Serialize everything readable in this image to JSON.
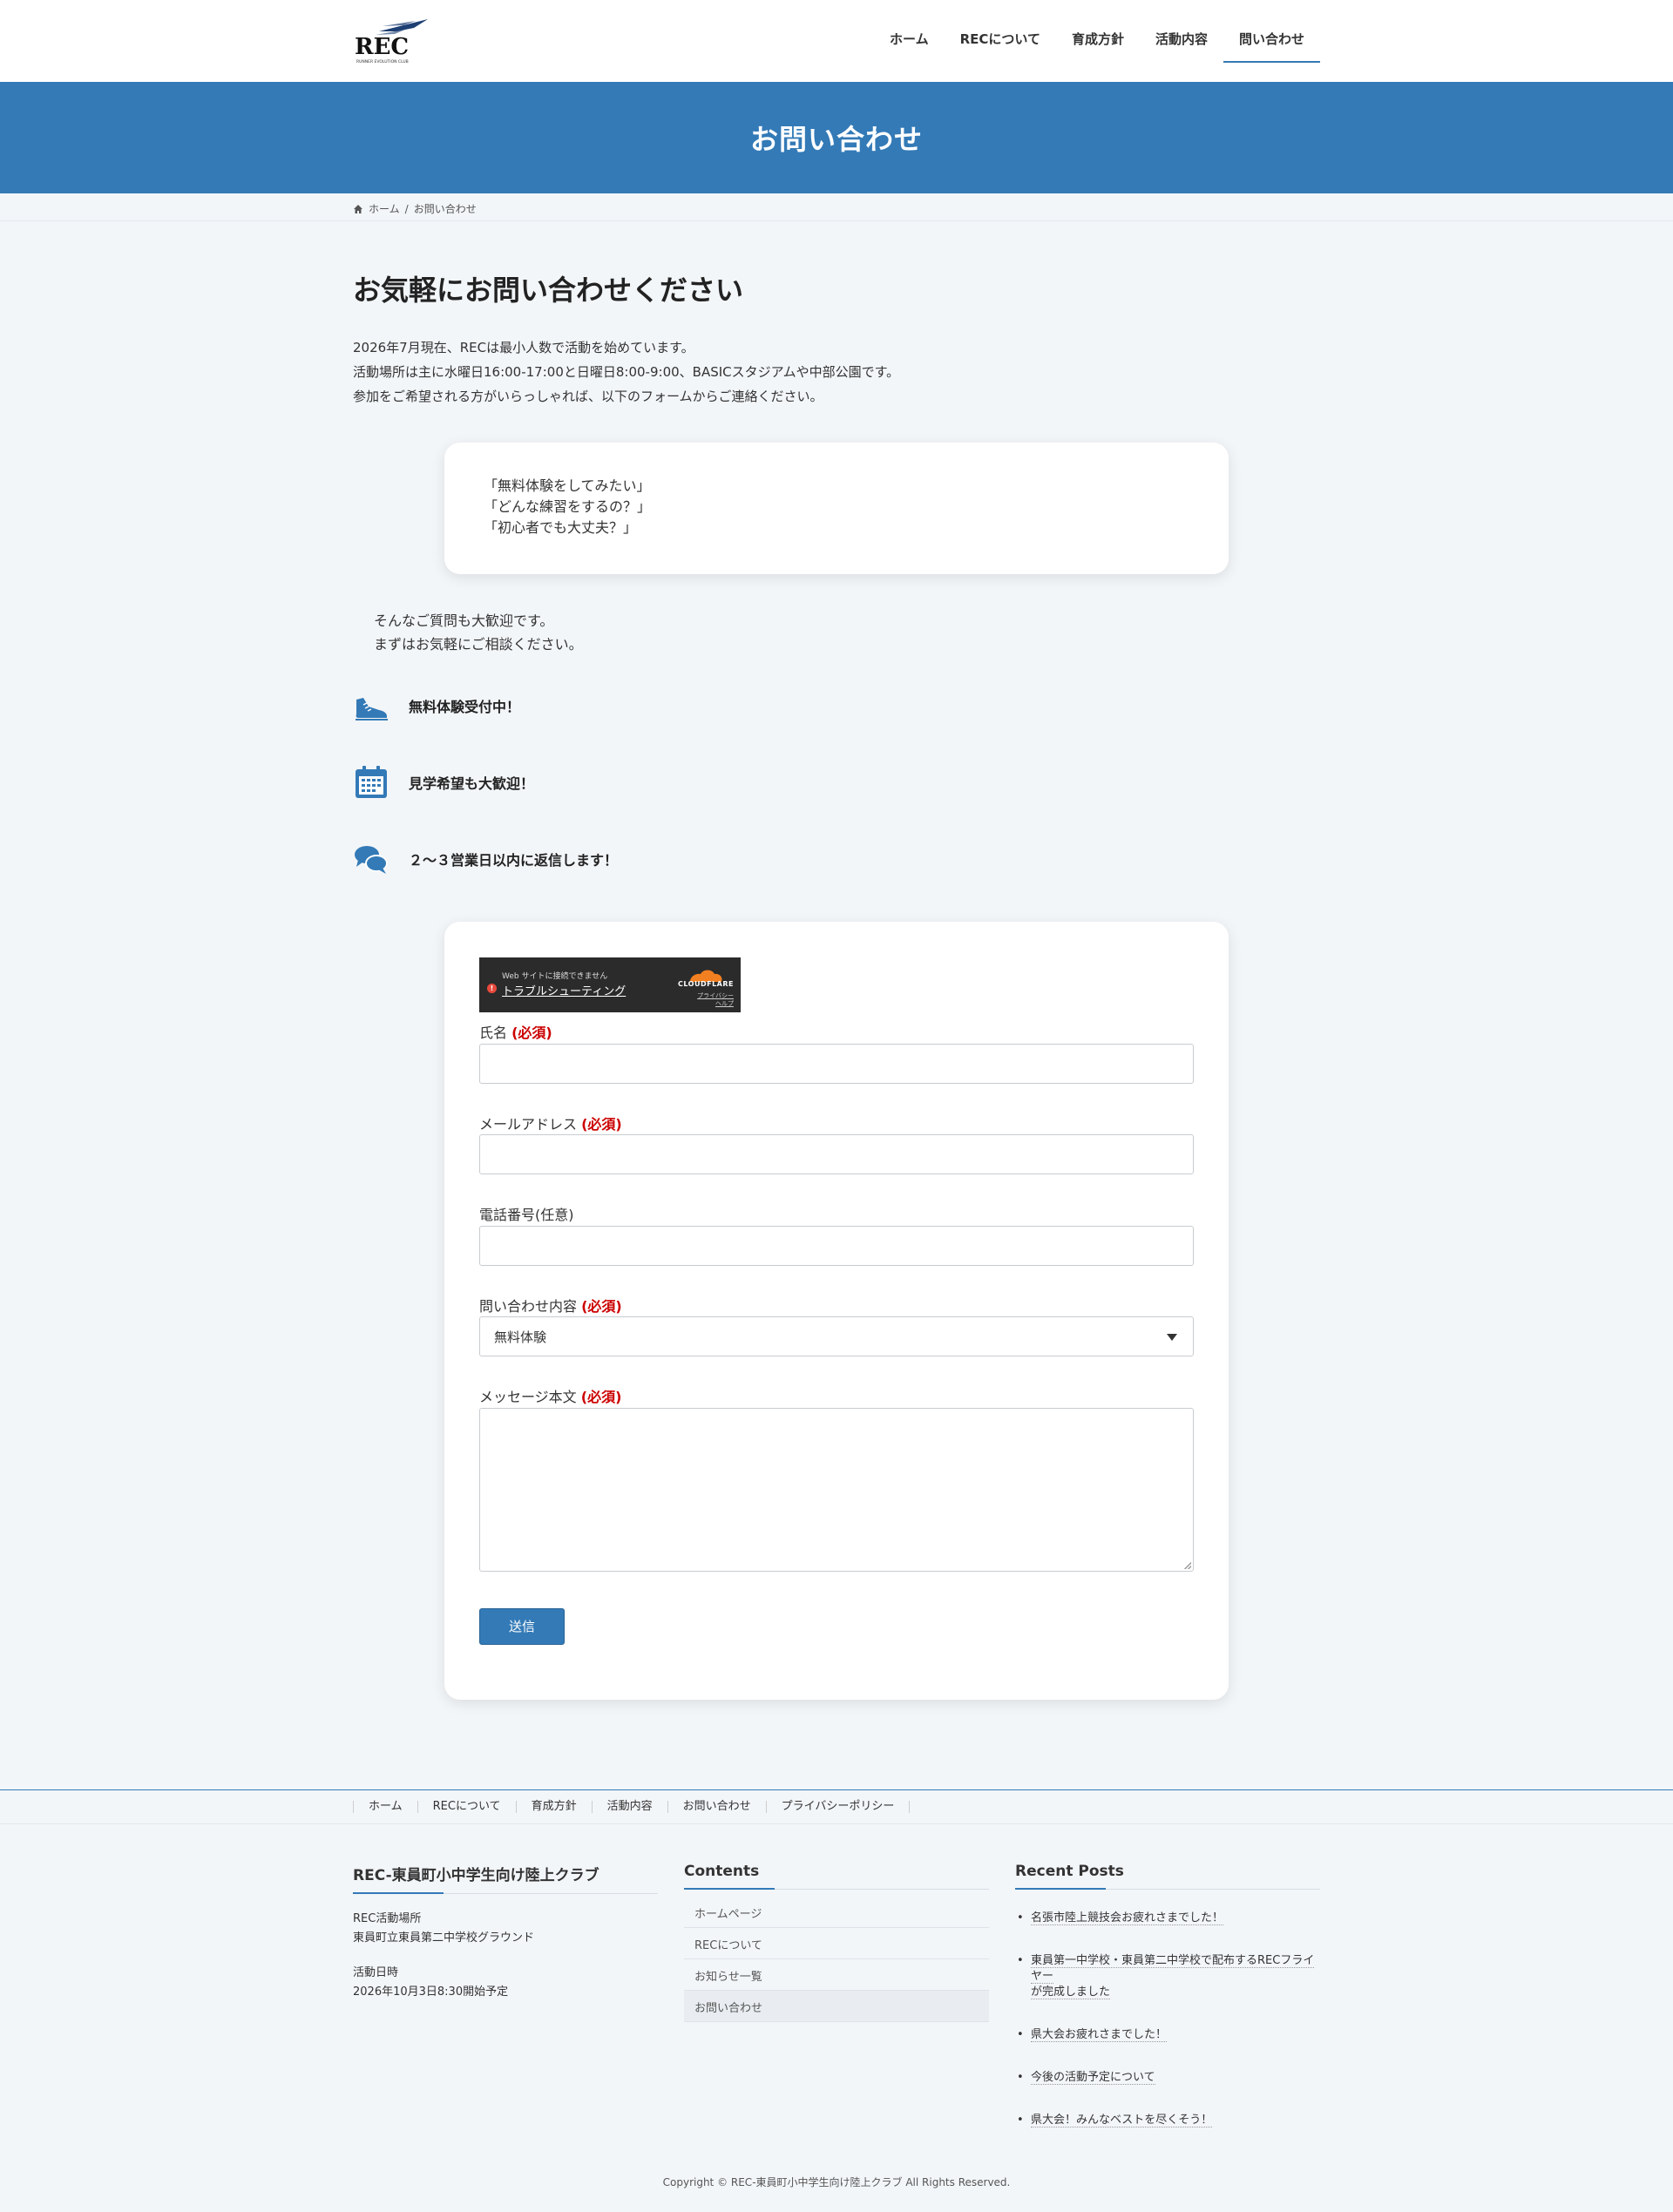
{
  "header": {
    "logo_text": "REC",
    "logo_sub": "RUNNER EVOLUTION CLUB",
    "nav": [
      {
        "label": "ホーム",
        "current": false
      },
      {
        "label": "RECについて",
        "current": false
      },
      {
        "label": "育成方針",
        "current": false
      },
      {
        "label": "活動内容",
        "current": false
      },
      {
        "label": "問い合わせ",
        "current": true
      }
    ]
  },
  "page_title": "お問い合わせ",
  "breadcrumb": {
    "home": "ホーム",
    "separator": "/",
    "current": "お問い合わせ"
  },
  "main": {
    "heading": "お気軽にお問い合わせください",
    "intro": [
      "2026年7月現在、RECは最小人数で活動を始めています。",
      "活動場所は主に水曜日16:00-17:00と日曜日8:00-9:00、BASICスタジアムや中部公園です。",
      "参加をご希望される方がいらっしゃれば、以下のフォームからご連絡ください。"
    ],
    "faq": [
      "「無料体験をしてみたい」",
      "「どんな練習をするの？」",
      "「初心者でも大丈夫？」"
    ],
    "welcome": [
      "そんなご質問も大歓迎です。",
      "まずはお気軽にご相談ください。"
    ],
    "features": [
      {
        "icon": "running-shoe-icon",
        "label": "無料体験受付中！"
      },
      {
        "icon": "calendar-icon",
        "label": "見学希望も大歓迎！"
      },
      {
        "icon": "chat-bubbles-icon",
        "label": "２～３営業日以内に返信します！"
      }
    ]
  },
  "captcha": {
    "message": "Web サイトに接続できません",
    "link": "トラブルシューティング",
    "brand": "CLOUDFLARE",
    "privacy": "プライバシー",
    "help": "ヘルプ"
  },
  "form": {
    "name_label": "氏名",
    "email_label": "メールアドレス",
    "phone_label": "電話番号(任意)",
    "inquiry_label": "問い合わせ内容",
    "inquiry_value": "無料体験",
    "message_label": "メッセージ本文",
    "required": "(必須)",
    "submit": "送信",
    "name_value": "",
    "email_value": "",
    "phone_value": "",
    "message_value": ""
  },
  "footer": {
    "nav": [
      "ホーム",
      "RECについて",
      "育成方針",
      "活動内容",
      "お問い合わせ",
      "プライバシーポリシー"
    ],
    "club_title": "REC-東員町小中学生向け陸上クラブ",
    "place_label": "REC活動場所",
    "place_value": "東員町立東員第二中学校グラウンド",
    "date_label": "活動日時",
    "date_value": "2026年10月3日8:30開始予定",
    "contents_title": "Contents",
    "contents": [
      {
        "label": "ホームページ",
        "active": false
      },
      {
        "label": "RECについて",
        "active": false
      },
      {
        "label": "お知らせ一覧",
        "active": false
      },
      {
        "label": "お問い合わせ",
        "active": true
      }
    ],
    "recent_title": "Recent Posts",
    "recent_posts": [
      [
        "名張市陸上競技会お疲れさまでした！"
      ],
      [
        "東員第一中学校・東員第二中学校で配布するRECフライヤー",
        "が完成しました"
      ],
      [
        "県大会お疲れさまでした！"
      ],
      [
        "今後の活動予定について"
      ],
      [
        "県大会！みんなベストを尽くそう！"
      ]
    ],
    "copyright": "Copyright © REC-東員町小中学生向け陸上クラブ All Rights Reserved."
  },
  "colors": {
    "accent": "#337ab7",
    "required": "#cc0000",
    "background": "#f3f6f9"
  }
}
